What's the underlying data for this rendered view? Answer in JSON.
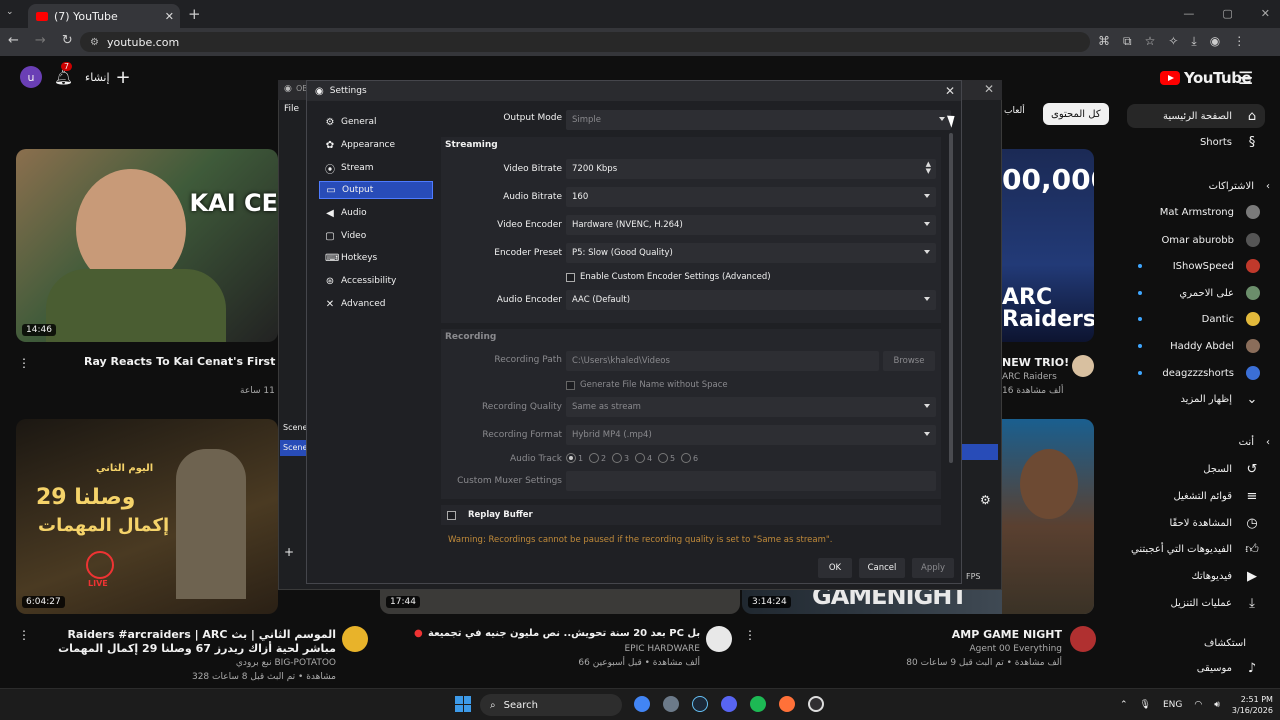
{
  "browser": {
    "tab_title": "(7) YouTube",
    "url": "youtube.com"
  },
  "youtube": {
    "logo_text": "YouTube",
    "avatar_letter": "u",
    "notification_count": "7",
    "create_label": "إنشاء",
    "chip_label": "كل المحتوى",
    "chip_left_label": "ألعاب",
    "sidebar": {
      "home": "الصفحة الرئيسية",
      "shorts": "Shorts",
      "subscriptions_header": "الاشتراكات",
      "channels": [
        "Mat Armstrong",
        "Omar aburobb",
        "IShowSpeed",
        "على الاحمري",
        "Dantic",
        "Haddy Abdel",
        "deagzzzshorts"
      ],
      "show_more": "إظهار المزيد",
      "you_header": "أنت",
      "you_items": [
        "السجل",
        "قوائم التشغيل",
        "المشاهدة لاحقًا",
        "الفيديوهات التي أعجبتني",
        "فيديوهاتك",
        "عمليات التنزيل"
      ],
      "explore_header": "استكشاف",
      "music": "موسيقى"
    },
    "videos": [
      {
        "title": "Ray Reacts To Kai Cenat's First Time Bac",
        "meta": "قبل 11 ساعة",
        "duration": "14:46",
        "thumb_text": "KAI CE"
      },
      {
        "title": "Raiders #arcraiders | ARC الموسم الثاني | بث مباشر لحية أزاك ريدرز 67 وصلنا 29 إكمال المهمات",
        "channel": "نبع برودي BIG-POTATOO",
        "meta": "328 مشاهدة • تم البث قبل 8 ساعات",
        "duration": "6:04:27",
        "thumb_text1": "اليوم الثاني",
        "thumb_text2": "وصلنا 29",
        "thumb_text3": "إكمال المهمات",
        "live_label": "LIVE"
      },
      {
        "title": "بعد 20 سنة تحويش.. نص مليون جنيه في تجميعة PC وكان هيروط بسبب كابل!",
        "channel": "EPIC HARDWARE",
        "meta": "66 ألف مشاهدة • قبل أسبوعين",
        "duration": "17:44"
      },
      {
        "title": "AMP GAME NIGHT",
        "channel": "Agent 00 Everything",
        "meta": "80 ألف مشاهدة • تم البث قبل 9 ساعات",
        "duration": "3:14:24",
        "thumb_text": "GAMENIGHT"
      },
      {
        "title": "NEW TRIO!",
        "channel": "ARC Raiders",
        "meta": "16 ألف مشاهدة",
        "thumb_text": "ARC Raiders",
        "thumb_text2": "00,000"
      }
    ]
  },
  "obs": {
    "main_title": "OBS",
    "file_menu": "File",
    "scenes_label": "Scene",
    "scene_item": "Scene",
    "fps_label": "FPS"
  },
  "settings": {
    "title": "Settings",
    "nav": [
      {
        "label": "General",
        "icon": "gear-icon"
      },
      {
        "label": "Appearance",
        "icon": "palette-icon"
      },
      {
        "label": "Stream",
        "icon": "signal-icon"
      },
      {
        "label": "Output",
        "icon": "output-icon"
      },
      {
        "label": "Audio",
        "icon": "speaker-icon"
      },
      {
        "label": "Video",
        "icon": "monitor-icon"
      },
      {
        "label": "Hotkeys",
        "icon": "keyboard-icon"
      },
      {
        "label": "Accessibility",
        "icon": "accessibility-icon"
      },
      {
        "label": "Advanced",
        "icon": "wrench-icon"
      }
    ],
    "selected_nav": "Output",
    "output_mode_label": "Output Mode",
    "output_mode_value": "Simple",
    "streaming_header": "Streaming",
    "video_bitrate_label": "Video Bitrate",
    "video_bitrate_value": "7200 Kbps",
    "audio_bitrate_label": "Audio Bitrate",
    "audio_bitrate_value": "160",
    "video_encoder_label": "Video Encoder",
    "video_encoder_value": "Hardware (NVENC, H.264)",
    "encoder_preset_label": "Encoder Preset",
    "encoder_preset_value": "P5: Slow (Good Quality)",
    "custom_encoder_label": "Enable Custom Encoder Settings (Advanced)",
    "audio_encoder_label": "Audio Encoder",
    "audio_encoder_value": "AAC (Default)",
    "recording_header": "Recording",
    "recording_path_label": "Recording Path",
    "recording_path_value": "C:\\Users\\khaled\\Videos",
    "browse_label": "Browse",
    "gen_filename_label": "Generate File Name without Space",
    "recording_quality_label": "Recording Quality",
    "recording_quality_value": "Same as stream",
    "recording_format_label": "Recording Format",
    "recording_format_value": "Hybrid MP4 (.mp4)",
    "audio_track_label": "Audio Track",
    "audio_tracks": [
      "1",
      "2",
      "3",
      "4",
      "5",
      "6"
    ],
    "custom_muxer_label": "Custom Muxer Settings",
    "replay_buffer_label": "Replay Buffer",
    "warning": "Warning: Recordings cannot be paused if the recording quality is set to \"Same as stream\".",
    "ok_label": "OK",
    "cancel_label": "Cancel",
    "apply_label": "Apply"
  },
  "taskbar": {
    "search_label": "Search",
    "lang": "ENG",
    "time": "2:51 PM",
    "date": "3/16/2026"
  }
}
